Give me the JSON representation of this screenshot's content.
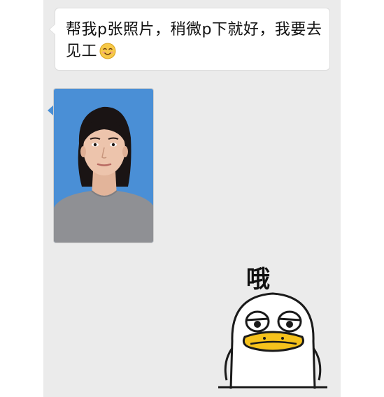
{
  "message": {
    "text": "帮我p张照片，稍微p下就好，我要去见工",
    "emoji": "smiling-face-emoji"
  },
  "photo": {
    "description_icon": "id-photo-portrait",
    "background_color": "#4a8fd6",
    "shirt_color": "#8f9094"
  },
  "sticker": {
    "caption": "哦",
    "icon": "duck-sticker"
  },
  "colors": {
    "chat_background": "#ebebeb",
    "page_background": "#ffffff",
    "bubble_background": "#ffffff"
  }
}
